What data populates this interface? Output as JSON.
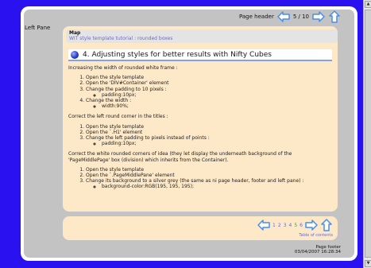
{
  "left_pane": {
    "label": "Left Pane"
  },
  "header": {
    "label": "Page header",
    "page_indicator": "5 / 10"
  },
  "map": {
    "title": "Map",
    "breadcrumb": "WIT style template tutorial : rounded boxes"
  },
  "section": {
    "title": "4. Adjusting styles for better results with Nifty Cubes"
  },
  "blocks": [
    {
      "intro": "Increasing the width of rounded white frame :",
      "items": [
        {
          "text": "Open the style template",
          "sub": []
        },
        {
          "text": "Open the 'DIV#Container' element",
          "sub": []
        },
        {
          "text": "Change the padding to 10 pixels :",
          "sub": [
            "padding:10px;"
          ]
        },
        {
          "text": "Change the width :",
          "sub": [
            "width:90%;"
          ]
        }
      ]
    },
    {
      "intro": "Correct the left round corner in the titles :",
      "items": [
        {
          "text": "Open the style template",
          "sub": []
        },
        {
          "text": "Open the `.H1' element",
          "sub": []
        },
        {
          "text": "Change the left padding to pixels instead of points :",
          "sub": [
            "padding:10px;"
          ]
        }
      ]
    },
    {
      "intro": "Correct the white rounded corners of idea (they let display the underneath background of the 'PageMiddlePage' box (division) which inherits from the Container).",
      "items": [
        {
          "text": "Open the style template",
          "sub": []
        },
        {
          "text": "Open the `.PageMiddlePane' element",
          "sub": []
        },
        {
          "text": "Change its background to a silver grey (the same as ni page header, footer and left pane) :",
          "sub": [
            "background-color:RGB(195, 195, 195);"
          ]
        }
      ]
    }
  ],
  "pagination": {
    "pages": [
      {
        "label": "1",
        "color": "#6a6ad0"
      },
      {
        "label": "2",
        "color": "#6a6ad0"
      },
      {
        "label": "3",
        "color": "#6a6ad0"
      },
      {
        "label": "4",
        "color": "#6a6ad0"
      },
      {
        "label": "5",
        "color": "#3aa83a"
      },
      {
        "label": "6",
        "color": "#6a6ad0"
      }
    ],
    "toc_label": "Table of contents"
  },
  "footer": {
    "label": "Page footer",
    "timestamp": "03/04/2007 16:28:34"
  },
  "colors": {
    "page_bg": "#2a12f0",
    "grey_pane": "#c3c3c3",
    "content_bg": "#fde8c8",
    "link": "#6a6ad0",
    "arrow": "#4a8ee8"
  }
}
